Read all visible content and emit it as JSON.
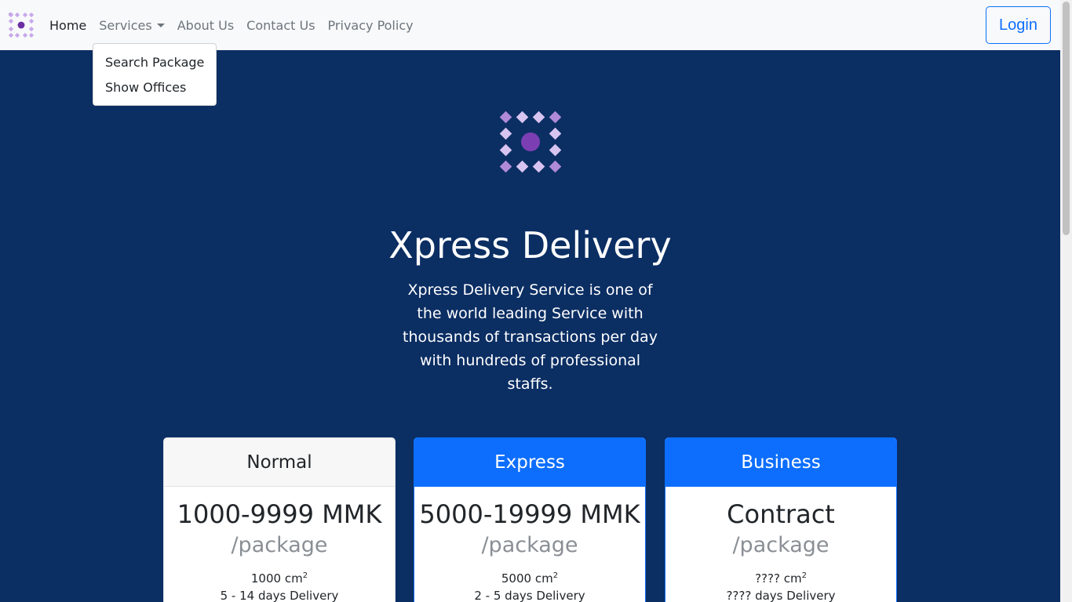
{
  "nav": {
    "brand_icon": "purple-diamond-grid-logo",
    "links": [
      {
        "label": "Home",
        "active": true
      },
      {
        "label": "Services"
      },
      {
        "label": "About Us"
      },
      {
        "label": "Contact Us"
      },
      {
        "label": "Privacy Policy"
      }
    ],
    "login_label": "Login"
  },
  "dropdown": {
    "items": [
      "Search Package",
      "Show Offices"
    ]
  },
  "hero": {
    "logo_icon": "purple-diamond-grid-logo",
    "title": "Xpress Delivery",
    "description": "Xpress Delivery Service is one of the world leading Service with thousands of transactions per day with hundreds of professional staffs."
  },
  "plans": [
    {
      "name": "Normal",
      "price": "1000-9999 MMK",
      "unit": "/package",
      "size": "1000",
      "size_unit": "cm",
      "size_sup": "2",
      "delivery": "5 - 14 days Delivery"
    },
    {
      "name": "Express",
      "price": "5000-19999 MMK",
      "unit": "/package",
      "size": "5000",
      "size_unit": "cm",
      "size_sup": "2",
      "delivery": "2 - 5 days Delivery"
    },
    {
      "name": "Business",
      "price": "Contract",
      "unit": "/package",
      "size": "????",
      "size_unit": "cm",
      "size_sup": "2",
      "delivery": "???? days Delivery"
    }
  ],
  "colors": {
    "background": "#0b2e63",
    "primary": "#0d6efd",
    "navbar": "#f8f9fa",
    "logo_purple": "#7b3fb3"
  }
}
